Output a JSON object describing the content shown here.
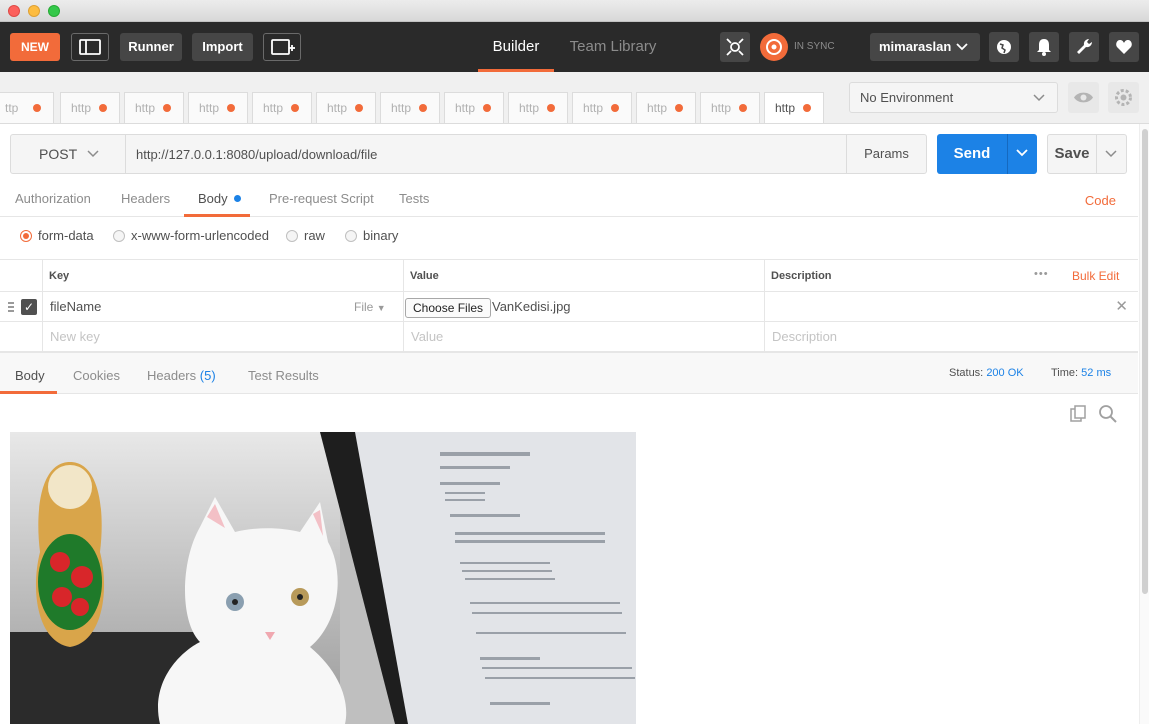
{
  "titlebar": {},
  "header": {
    "new_label": "NEW",
    "runner_label": "Runner",
    "import_label": "Import",
    "tabs": [
      {
        "label": "Builder"
      },
      {
        "label": "Team Library"
      }
    ],
    "sync_label": "IN SYNC",
    "username": "mimaraslan",
    "icons": [
      "sidebar-toggle-icon",
      "new-window-icon",
      "interceptor-icon",
      "sync-icon",
      "chevron-down-icon",
      "globe-icon",
      "bell-icon",
      "wrench-icon",
      "heart-icon"
    ],
    "accent_color": "#f26b3a"
  },
  "request_tabs": [
    {
      "label": "ttp"
    },
    {
      "label": "http"
    },
    {
      "label": "http"
    },
    {
      "label": "http"
    },
    {
      "label": "http"
    },
    {
      "label": "http"
    },
    {
      "label": "http"
    },
    {
      "label": "http"
    },
    {
      "label": "http"
    },
    {
      "label": "http"
    },
    {
      "label": "http"
    },
    {
      "label": "http"
    },
    {
      "label": "http"
    }
  ],
  "environment": {
    "selected": "No Environment"
  },
  "request": {
    "method": "POST",
    "url": "http://127.0.0.1:8080/upload/download/file",
    "params_label": "Params",
    "send_label": "Send",
    "save_label": "Save",
    "send_color": "#1c82e6"
  },
  "request_subtabs": {
    "authorization": "Authorization",
    "headers": "Headers",
    "body": "Body",
    "prerequest": "Pre-request Script",
    "tests": "Tests",
    "code": "Code"
  },
  "body_modes": {
    "form_data": "form-data",
    "urlencoded": "x-www-form-urlencoded",
    "raw": "raw",
    "binary": "binary",
    "selected": "form-data"
  },
  "params_table": {
    "headers": {
      "key": "Key",
      "value": "Value",
      "description": "Description",
      "more": "•••",
      "bulk_edit": "Bulk Edit"
    },
    "rows": [
      {
        "key": "fileName",
        "type": "File",
        "choose_label": "Choose Files",
        "file": "VanKedisi.jpg",
        "description": "",
        "checked": true
      }
    ],
    "new_row": {
      "key_placeholder": "New key",
      "value_placeholder": "Value",
      "description_placeholder": "Description"
    }
  },
  "response": {
    "tabs": {
      "body": "Body",
      "cookies": "Cookies",
      "headers": "Headers",
      "headers_count": "(5)",
      "test_results": "Test Results"
    },
    "status_label": "Status:",
    "status_value": "200 OK",
    "time_label": "Time:",
    "time_value": "52 ms",
    "icons": [
      "copy-icon",
      "search-icon"
    ]
  }
}
